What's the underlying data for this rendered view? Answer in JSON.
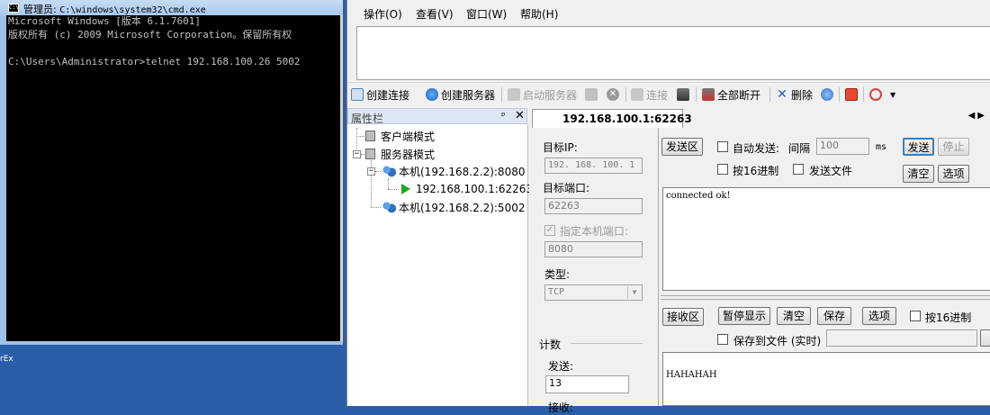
{
  "cmd": {
    "title_prefix": "管理员: ",
    "title_path": "C:\\windows\\system32\\cmd.exe",
    "icon_text": "C:\\",
    "lines": [
      "Microsoft Windows [版本 6.1.7601]",
      "版权所有 (c) 2009 Microsoft Corporation。保留所有权",
      "",
      "C:\\Users\\Administrator>telnet 192.168.100.26 5002"
    ]
  },
  "desktop": {
    "fragment": "rEx"
  },
  "menu": [
    {
      "label": "操作(O)"
    },
    {
      "label": "查看(V)"
    },
    {
      "label": "窗口(W)"
    },
    {
      "label": "帮助(H)"
    }
  ],
  "toolbar": {
    "create_connection": "创建连接",
    "create_server": "创建服务器",
    "start_server": "启动服务器",
    "connect": "连接",
    "disconnect_all": "全部断开",
    "delete": "删除"
  },
  "left_panel": {
    "title": "属性栏",
    "pin": "ᵖ",
    "close": "✕",
    "tree": {
      "client_mode": "客户端模式",
      "server_mode": "服务器模式",
      "server1": "本机(192.168.2.2):8080",
      "connection1": "192.168.100.1:62263",
      "server2": "本机(192.168.2.2):5002"
    }
  },
  "tab": {
    "label": "192.168.100.1:62263",
    "nav": "◀▶"
  },
  "session": {
    "target_ip_label": "目标IP:",
    "target_ip": "192. 168. 100. 1",
    "target_port_label": "目标端口:",
    "target_port": "62263",
    "local_port_label": "指定本机端口:",
    "local_port": "8080",
    "type_label": "类型:",
    "type": "TCP",
    "count_label": "计数",
    "send_label": "发送:",
    "send_count": "13",
    "recv_label": "接收:"
  },
  "send_area": {
    "title": "发送区",
    "auto_send": "自动发送:",
    "interval_label": "间隔",
    "interval": "100",
    "unit": "ms",
    "send_button": "发送",
    "stop_button": "停止",
    "hex16": "按16进制",
    "send_file": "发送文件",
    "clear_button": "清空",
    "options_button": "选项",
    "content": "connected ok!"
  },
  "recv_area": {
    "title": "接收区",
    "pause": "暂停显示",
    "clear": "清空",
    "save": "保存",
    "options": "选项",
    "hex16": "按16进制",
    "save_to_file": "保存到文件 (实时)",
    "content": "HAHAHAH"
  }
}
